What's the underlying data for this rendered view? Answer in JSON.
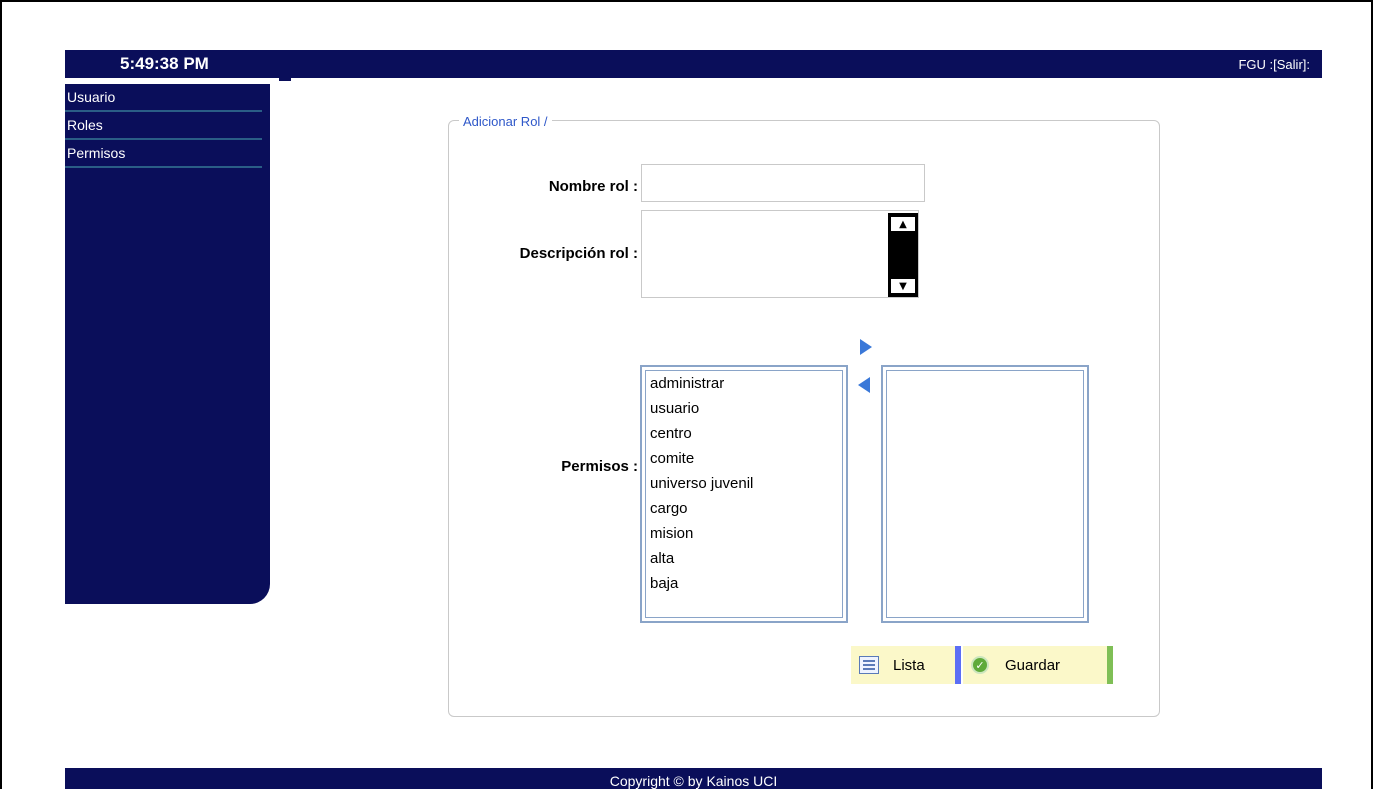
{
  "header": {
    "clock": "5:49:38 PM",
    "user_info": "FGU :[Salir]:"
  },
  "sidebar": {
    "items": [
      {
        "label": "Usuario"
      },
      {
        "label": "Roles"
      },
      {
        "label": "Permisos"
      }
    ]
  },
  "form": {
    "legend": "Adicionar Rol /",
    "nombre_label": "Nombre rol :",
    "nombre_value": "",
    "descripcion_label": "Descripción rol :",
    "descripcion_value": "",
    "permisos_label": "Permisos :",
    "available_permissions": [
      "administrar",
      "usuario",
      "centro",
      "comite",
      "universo juvenil",
      "cargo",
      "mision",
      "alta",
      "baja"
    ],
    "selected_permissions": []
  },
  "buttons": {
    "lista": "Lista",
    "guardar": "Guardar"
  },
  "icons": {
    "add_arrow": "arrow-right-icon",
    "remove_arrow": "arrow-left-icon",
    "scroll_up": "scroll-up-icon",
    "scroll_down": "scroll-down-icon",
    "lista": "list-icon",
    "guardar": "check-circle-icon"
  },
  "colors": {
    "navy": "#0a0e5a",
    "accent_blue": "#3a78d8",
    "button_bg": "#fbf8c9"
  },
  "footer": {
    "text": "Copyright © by Kainos UCI"
  }
}
